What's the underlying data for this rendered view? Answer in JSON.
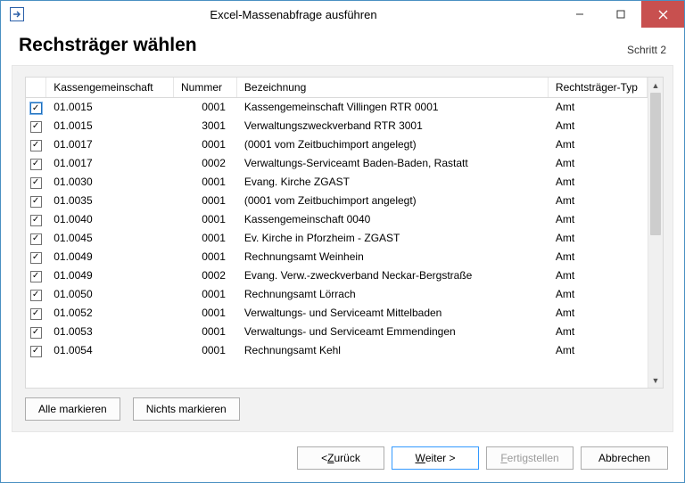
{
  "window": {
    "title": "Excel-Massenabfrage ausführen"
  },
  "header": {
    "title": "Rechsträger wählen",
    "step": "Schritt 2"
  },
  "table": {
    "headers": {
      "kg": "Kassengemeinschaft",
      "num": "Nummer",
      "bez": "Bezeichnung",
      "typ": "Rechtsträger-Typ"
    },
    "rows": [
      {
        "checked": true,
        "kg": "01.0015",
        "num": "0001",
        "bez": "Kassengemeinschaft Villingen RTR 0001",
        "typ": "Amt"
      },
      {
        "checked": true,
        "kg": "01.0015",
        "num": "3001",
        "bez": "Verwaltungszweckverband RTR 3001",
        "typ": "Amt"
      },
      {
        "checked": true,
        "kg": "01.0017",
        "num": "0001",
        "bez": "(0001 vom Zeitbuchimport angelegt)",
        "typ": "Amt"
      },
      {
        "checked": true,
        "kg": "01.0017",
        "num": "0002",
        "bez": "Verwaltungs-Serviceamt Baden-Baden, Rastatt",
        "typ": "Amt"
      },
      {
        "checked": true,
        "kg": "01.0030",
        "num": "0001",
        "bez": "Evang. Kirche ZGAST",
        "typ": "Amt"
      },
      {
        "checked": true,
        "kg": "01.0035",
        "num": "0001",
        "bez": "(0001 vom Zeitbuchimport angelegt)",
        "typ": "Amt"
      },
      {
        "checked": true,
        "kg": "01.0040",
        "num": "0001",
        "bez": "Kassengemeinschaft 0040",
        "typ": "Amt"
      },
      {
        "checked": true,
        "kg": "01.0045",
        "num": "0001",
        "bez": "Ev. Kirche in Pforzheim - ZGAST",
        "typ": "Amt"
      },
      {
        "checked": true,
        "kg": "01.0049",
        "num": "0001",
        "bez": "Rechnungsamt Weinhein",
        "typ": "Amt"
      },
      {
        "checked": true,
        "kg": "01.0049",
        "num": "0002",
        "bez": "Evang. Verw.-zweckverband Neckar-Bergstraße",
        "typ": "Amt"
      },
      {
        "checked": true,
        "kg": "01.0050",
        "num": "0001",
        "bez": "Rechnungsamt Lörrach",
        "typ": "Amt"
      },
      {
        "checked": true,
        "kg": "01.0052",
        "num": "0001",
        "bez": "Verwaltungs- und Serviceamt Mittelbaden",
        "typ": "Amt"
      },
      {
        "checked": true,
        "kg": "01.0053",
        "num": "0001",
        "bez": "Verwaltungs- und Serviceamt Emmendingen",
        "typ": "Amt"
      },
      {
        "checked": true,
        "kg": "01.0054",
        "num": "0001",
        "bez": "Rechnungsamt Kehl",
        "typ": "Amt"
      }
    ]
  },
  "buttons": {
    "select_all": "Alle markieren",
    "select_none": "Nichts markieren",
    "back_prefix": "< ",
    "back_mn": "Z",
    "back_rest": "urück",
    "next_mn": "W",
    "next_rest": "eiter >",
    "finish_mn": "F",
    "finish_rest": "ertigstellen",
    "cancel": "Abbrechen"
  }
}
